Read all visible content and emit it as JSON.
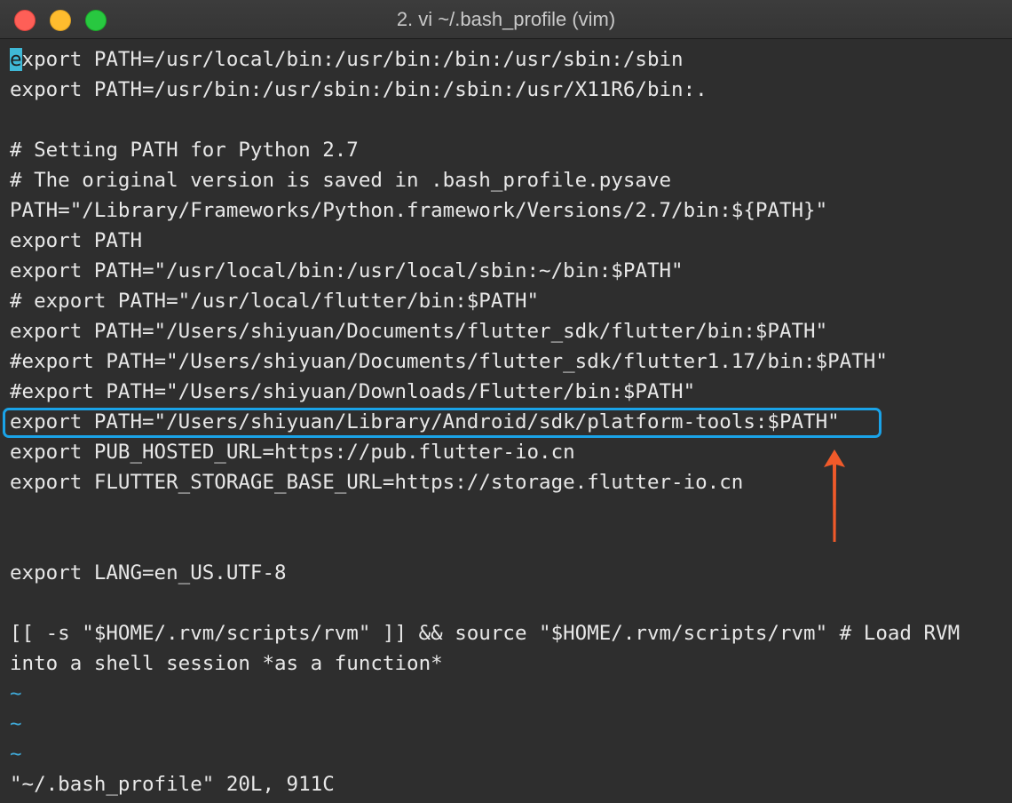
{
  "window": {
    "title": "2. vi ~/.bash_profile (vim)"
  },
  "editor": {
    "cursor_char": "e",
    "first_line_rest": "xport PATH=/usr/local/bin:/usr/bin:/bin:/usr/sbin:/sbin",
    "lines": [
      "export PATH=/usr/bin:/usr/sbin:/bin:/sbin:/usr/X11R6/bin:.",
      "",
      "# Setting PATH for Python 2.7",
      "# The original version is saved in .bash_profile.pysave",
      "PATH=\"/Library/Frameworks/Python.framework/Versions/2.7/bin:${PATH}\"",
      "export PATH",
      "export PATH=\"/usr/local/bin:/usr/local/sbin:~/bin:$PATH\"",
      "# export PATH=\"/usr/local/flutter/bin:$PATH\"",
      "export PATH=\"/Users/shiyuan/Documents/flutter_sdk/flutter/bin:$PATH\"",
      "#export PATH=\"/Users/shiyuan/Documents/flutter_sdk/flutter1.17/bin:$PATH\"",
      "#export PATH=\"/Users/shiyuan/Downloads/Flutter/bin:$PATH\"",
      "export PATH=\"/Users/shiyuan/Library/Android/sdk/platform-tools:$PATH\"",
      "export PUB_HOSTED_URL=https://pub.flutter-io.cn",
      "export FLUTTER_STORAGE_BASE_URL=https://storage.flutter-io.cn",
      "",
      "",
      "export LANG=en_US.UTF-8",
      "",
      "[[ -s \"$HOME/.rvm/scripts/rvm\" ]] && source \"$HOME/.rvm/scripts/rvm\" # Load RVM",
      "into a shell session *as a function*"
    ],
    "tildes": [
      "~",
      "~",
      "~"
    ],
    "status_line": "\"~/.bash_profile\" 20L, 911C"
  },
  "annotations": {
    "highlight_color": "#1aa3e8",
    "arrow_color": "#f05a2a"
  }
}
